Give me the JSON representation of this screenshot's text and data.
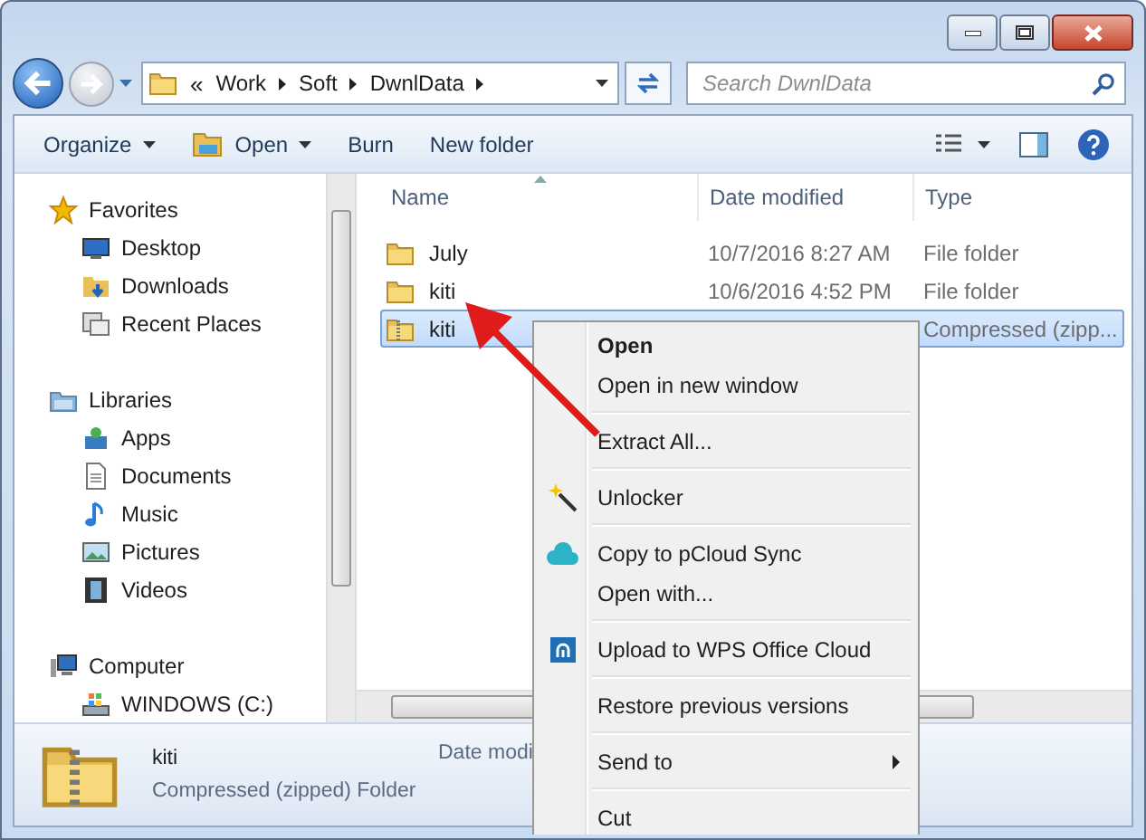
{
  "navigation": {
    "back": {
      "disabled": false
    },
    "forward": {
      "disabled": true
    }
  },
  "address": {
    "overflow": "«",
    "crumbs": [
      "Work",
      "Soft",
      "DwnlData"
    ]
  },
  "search": {
    "placeholder": "Search DwnlData"
  },
  "toolbar": [
    {
      "label": "Organize",
      "dropdown": true
    },
    {
      "label": "Open",
      "dropdown": true
    },
    {
      "label": "Burn",
      "dropdown": false
    },
    {
      "label": "New folder",
      "dropdown": false
    }
  ],
  "sidebar": {
    "groups": [
      {
        "label": "Favorites",
        "children": [
          {
            "label": "Desktop"
          },
          {
            "label": "Downloads"
          },
          {
            "label": "Recent Places"
          }
        ]
      },
      {
        "label": "Libraries",
        "children": [
          {
            "label": "Apps"
          },
          {
            "label": "Documents"
          },
          {
            "label": "Music"
          },
          {
            "label": "Pictures"
          },
          {
            "label": "Videos"
          }
        ]
      },
      {
        "label": "Computer",
        "children": [
          {
            "label": "WINDOWS (C:)"
          }
        ]
      }
    ]
  },
  "file_list": {
    "columns": [
      "Name",
      "Date modified",
      "Type"
    ],
    "rows": [
      {
        "name": "July",
        "date": "10/7/2016 8:27 AM",
        "type": "File folder",
        "kind": "folder",
        "selected": false
      },
      {
        "name": "kiti",
        "date": "10/6/2016 4:52 PM",
        "type": "File folder",
        "kind": "folder",
        "selected": false
      },
      {
        "name": "kiti",
        "type": "Compressed (zipp...",
        "kind": "zip",
        "selected": true
      }
    ]
  },
  "details": {
    "name": "kiti",
    "type": "Compressed (zipped) Folder",
    "field_label": "Date modi"
  },
  "context_menu": {
    "groups": [
      [
        {
          "label": "Open",
          "default": true,
          "submenu": false
        },
        {
          "label": "Open in new window",
          "default": false,
          "submenu": false
        }
      ],
      [
        {
          "label": "Extract All...",
          "default": false,
          "submenu": false
        }
      ],
      [
        {
          "label": "Unlocker",
          "default": false,
          "submenu": false
        }
      ],
      [
        {
          "label": "Copy to pCloud Sync",
          "default": false,
          "submenu": false
        },
        {
          "label": "Open with...",
          "default": false,
          "submenu": false
        }
      ],
      [
        {
          "label": "Upload to WPS Office Cloud",
          "default": false,
          "submenu": false
        }
      ],
      [
        {
          "label": "Restore previous versions",
          "default": false,
          "submenu": false
        }
      ],
      [
        {
          "label": "Send to",
          "default": false,
          "submenu": true
        }
      ],
      [
        {
          "label": "Cut",
          "default": false,
          "submenu": false
        }
      ]
    ]
  }
}
